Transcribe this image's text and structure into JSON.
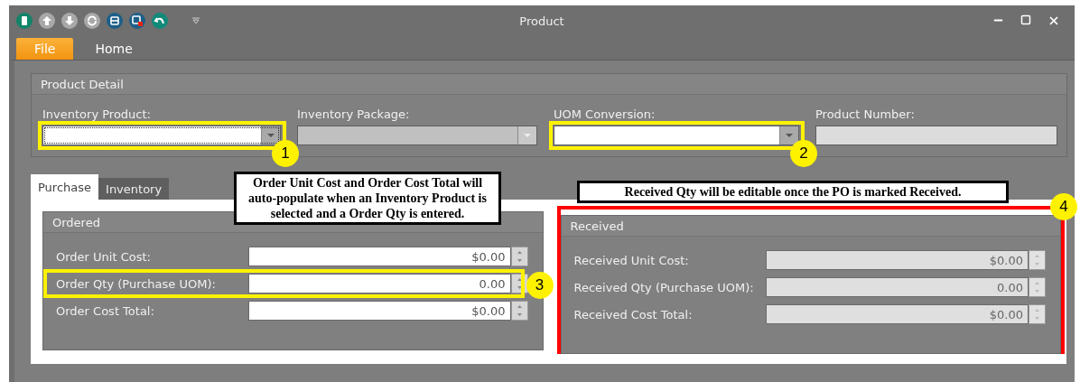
{
  "window": {
    "title": "Product"
  },
  "ribbon_tabs": [
    {
      "label": "File",
      "selected": true
    },
    {
      "label": "Home",
      "selected": false
    }
  ],
  "product_detail": {
    "title": "Product Detail",
    "fields": [
      {
        "label": "Inventory Product:",
        "kind": "combo",
        "disabled": false,
        "focused": true,
        "marker": "1"
      },
      {
        "label": "Inventory Package:",
        "kind": "combo",
        "disabled": true,
        "focused": false
      },
      {
        "label": "UOM Conversion:",
        "kind": "combo",
        "disabled": false,
        "focused": false,
        "marker": "2"
      },
      {
        "label": "Product Number:",
        "kind": "text",
        "disabled": true,
        "focused": false
      }
    ]
  },
  "tabs": [
    {
      "label": "Purchase",
      "selected": true
    },
    {
      "label": "Inventory",
      "selected": false
    }
  ],
  "notes": [
    "Order Unit Cost and Order Cost Total will auto-populate when an Inventory Product is selected and a Order Qty is entered.",
    "Received Qty will be editable once the PO is marked Received."
  ],
  "groups": [
    {
      "title": "Ordered",
      "disabled": false,
      "rows": [
        {
          "label": "Order Unit Cost:",
          "value": "$0.00"
        },
        {
          "label": "Order Qty (Purchase UOM):",
          "value": "0.00",
          "marker": "3"
        },
        {
          "label": "Order Cost Total:",
          "value": "$0.00"
        }
      ]
    },
    {
      "title": "Received",
      "disabled": true,
      "marker": "4",
      "rows": [
        {
          "label": "Received Unit Cost:",
          "value": "$0.00"
        },
        {
          "label": "Received Qty (Purchase UOM):",
          "value": "0.00"
        },
        {
          "label": "Received Cost Total:",
          "value": "$0.00"
        }
      ]
    }
  ]
}
